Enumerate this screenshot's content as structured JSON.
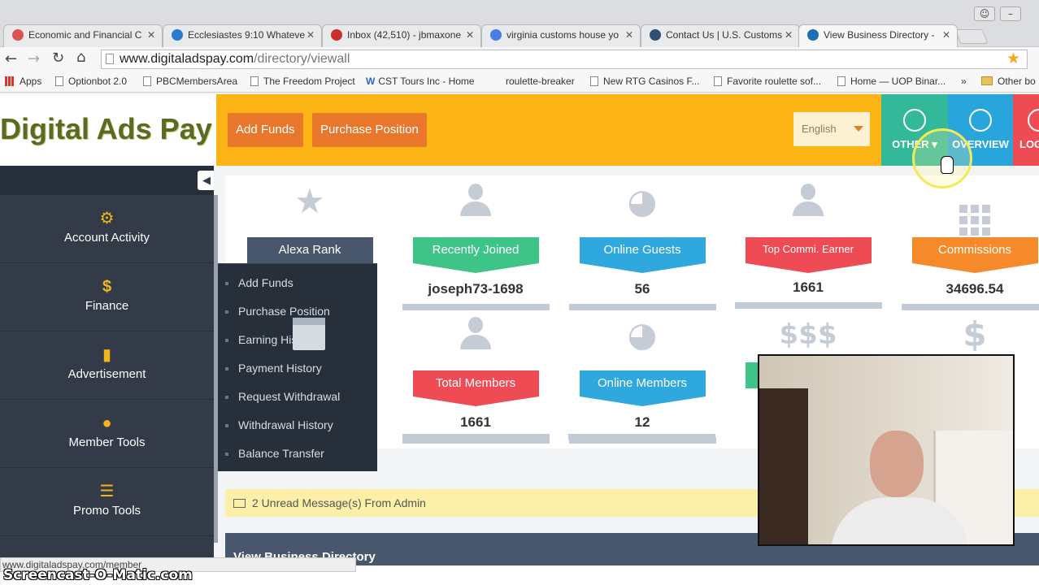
{
  "browser": {
    "tabs": [
      {
        "title": "Economic and Financial C",
        "favicon_color": "#d9534f"
      },
      {
        "title": "Ecclesiastes 9:10 Whateve",
        "favicon_color": "#2a7ad2"
      },
      {
        "title": "Inbox (42,510) - jbmaxone",
        "favicon_color": "#c9302c"
      },
      {
        "title": "virginia customs house yo",
        "favicon_color": "#4a7de6"
      },
      {
        "title": "Contact Us | U.S. Customs",
        "favicon_color": "#324d74"
      },
      {
        "title": "View Business Directory -",
        "favicon_color": "#1b6fb5"
      }
    ],
    "url_domain": "www.digitaladspay.com",
    "url_path": "/directory/viewall",
    "bookmarks": [
      "Apps",
      "Optionbot 2.0",
      "PBCMembersArea",
      "The Freedom Project",
      "CST Tours Inc - Home",
      "roulette-breaker",
      "New RTG Casinos F...",
      "Favorite roulette sof...",
      "Home — UOP Binar...",
      "»",
      "Other bo"
    ],
    "status_url": "www.digitaladspay.com/member"
  },
  "header": {
    "logo": "Digital Ads Pay",
    "add_funds": "Add Funds",
    "purchase_position": "Purchase Position",
    "language": "English",
    "nav": [
      {
        "label": "OTHER ▾",
        "color": "#33b99a"
      },
      {
        "label": "OVERVIEW",
        "color": "#28a6dc"
      },
      {
        "label": "LOG",
        "color": "#ef4b55"
      }
    ]
  },
  "sidebar": {
    "items": [
      {
        "label": "Account Activity",
        "icon": "gear-icon",
        "glyph": "⚙"
      },
      {
        "label": "Finance",
        "icon": "dollar-icon",
        "glyph": "$"
      },
      {
        "label": "Advertisement",
        "icon": "file-icon",
        "glyph": "▮"
      },
      {
        "label": "Member Tools",
        "icon": "user-icon",
        "glyph": "●"
      },
      {
        "label": "Promo Tools",
        "icon": "list-icon",
        "glyph": "☰"
      }
    ],
    "finance_menu": [
      "Add Funds",
      "Purchase Position",
      "Earning His",
      "Payment History",
      "Request Withdrawal",
      "Withdrawal History",
      "Balance Transfer"
    ]
  },
  "stats": [
    {
      "label": "Alexa Rank",
      "value": "",
      "color": "#48576b",
      "icon": "star-icon"
    },
    {
      "label": "Recently Joined",
      "value": "joseph73-1698",
      "color": "#3ec487",
      "icon": "user-icon"
    },
    {
      "label": "Online Guests",
      "value": "56",
      "color": "#2fa8dd",
      "icon": "globe-icon"
    },
    {
      "label": "Top Commi. Earner",
      "value": "1661",
      "color": "#ef4b55",
      "icon": "user-icon"
    },
    {
      "label": "Commissions",
      "value": "34696.54",
      "color": "#f68a2a",
      "icon": "grid-icon"
    },
    {
      "label": "Total Members",
      "value": "1661",
      "color": "#ef4b55",
      "icon": "user-icon"
    },
    {
      "label": "Online Members",
      "value": "12",
      "color": "#2fa8dd",
      "icon": "globe-icon"
    }
  ],
  "message": "2 Unread Message(s) From Admin",
  "section_title": "View Business Directory",
  "watermark": "Screencast-O-Matic.com"
}
